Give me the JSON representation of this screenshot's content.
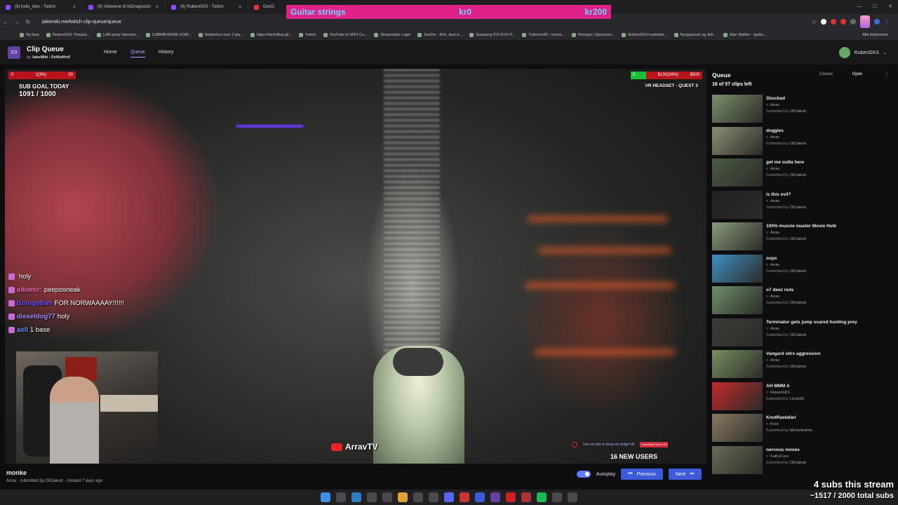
{
  "browser": {
    "tabs": [
      {
        "label": "(9) hello_kiko - Twitch"
      },
      {
        "label": "(9) Videoene til ItsDragonish"
      },
      {
        "label": "(9) RubenGKS - Twitch"
      },
      {
        "label": "GeoG"
      }
    ],
    "url": "jakemiki.me/twitch-clip-queue/queue",
    "bookmarks": [
      "Ny fane",
      "RubenGKS Timepla...",
      "LAN-party hjemme...",
      "SJØRØVERNE KOM...",
      "Rekkehus over 2 pla...",
      "https://fan1tilkai.git...",
      "Twitch",
      "YouTube to MP3 Co...",
      "Streamlabs Login",
      "XeqTer - Ehh, skal vi...",
      "Samsung 970 EVO P...",
      "Tullemor93 - reinsk...",
      "Wehype | Sponsors...",
      "RubenGKS huskelist...",
      "Nyoppusset og deli...",
      "Alan Walker - Ignite..."
    ],
    "bookmarks_right": "Alle bokmerker"
  },
  "overlay_banner": {
    "name": "Guitar strings",
    "current": "kr0",
    "goal": "kr200"
  },
  "app": {
    "title": "Clip Queue",
    "by_prefix": "by",
    "author1": "JakeMiki",
    "author2": "SirMuffin9",
    "nav": {
      "home": "Home",
      "queue": "Queue",
      "history": "History"
    },
    "username": "RubenGKS"
  },
  "stream_overlay": {
    "hud_left": {
      "a": "0",
      "b": "1(3%)",
      "c": "30"
    },
    "hud_right": {
      "a": "0",
      "b": "$130(26%)",
      "c": "$500"
    },
    "sub_goal_label": "SUB GOAL TODAY",
    "sub_goal_value": "1091 / 1000",
    "vr_text": "VR HEADSET - QUEST 3",
    "watermark": "ArravTV",
    "alert_text": "Use my link to keep my fridge full",
    "alert_pill": "Download Opera GX",
    "new_users": "16 NEW USERS",
    "stream_subs": "4 subs this stream",
    "total_subs": "~1517 / 2000 total subs"
  },
  "chat": [
    {
      "user": "",
      "msg": "holy",
      "cls": "u1"
    },
    {
      "user": "sikonic:",
      "msg": "peeposneak",
      "cls": "u2"
    },
    {
      "user": "BoingoBan",
      "msg": "FOR NORWAAAAY!!!!!!",
      "cls": "u3"
    },
    {
      "user": "dieseldog77",
      "msg": "holy",
      "cls": "u4"
    },
    {
      "user": "axll",
      "msg": "1  base",
      "cls": "u5"
    }
  ],
  "current_clip": {
    "title": "monke",
    "channel": "Arrav",
    "submitted_label": "submitted by",
    "submitter": "Ol3Jakob",
    "created": "created 7 days ago"
  },
  "controls": {
    "autoplay": "Autoplay",
    "previous": "Previous",
    "next": "Next"
  },
  "queue": {
    "title": "Queue",
    "count": "16 of 57 clips left",
    "tab_closed": "Closed",
    "tab_open": "Open",
    "submitted_prefix": "Submitted by",
    "items": [
      {
        "title": "Shocked",
        "channel": "Arrav",
        "submitter": "Ol3Jakob",
        "color": "#7c8f6a"
      },
      {
        "title": "doggies",
        "channel": "Arrav",
        "submitter": "Ol3Jakob",
        "color": "#8a8f72"
      },
      {
        "title": "get me outta here",
        "channel": "Arrav",
        "submitter": "Ol3Jakob",
        "color": "#4c5a44"
      },
      {
        "title": "is this evil?",
        "channel": "Arrav",
        "submitter": "Ol3Jakob",
        "color": "#1e2220"
      },
      {
        "title": "100% muscle master Movie Hulk",
        "channel": "Arrav",
        "submitter": "Ol3Jakob",
        "color": "#8a9a7a"
      },
      {
        "title": "oops",
        "channel": "Arrav",
        "submitter": "Ol3Jakob",
        "color": "#3f8fc4"
      },
      {
        "title": "o7 deez nuts",
        "channel": "Arrav",
        "submitter": "Ol3Jakob",
        "color": "#6f8f6a"
      },
      {
        "title": "Terminator gets jump scared hunting prey",
        "channel": "Arrav",
        "submitter": "Ol3Jakob",
        "color": "#3a3c38"
      },
      {
        "title": "Vangard stirs aggression",
        "channel": "Arrav",
        "submitter": "Ol3Jakob",
        "color": "#7a8f62"
      },
      {
        "title": "AH MMM A",
        "channel": "RubenGKS",
        "submitter": "Linnis96",
        "color": "#c42a2a"
      },
      {
        "title": "KnutRastafari",
        "channel": "Knut",
        "submitter": "MichelleeFtw",
        "color": "#8a7a62"
      },
      {
        "title": "nervous noises",
        "channel": "KathyCore",
        "submitter": "Ol3Jakob",
        "color": "#6a6a58"
      }
    ]
  }
}
